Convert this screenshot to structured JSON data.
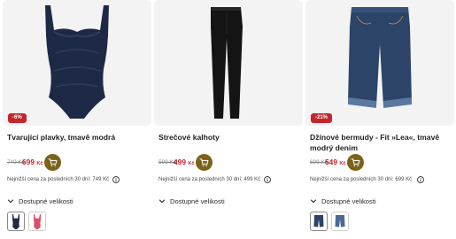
{
  "products": [
    {
      "badge": "-6%",
      "title": "Tvarující plavky, tmavě modrá",
      "old_price": "749 Kč",
      "new_price": "699",
      "currency": "Kč",
      "lowest_price": "Nejnižší cena za posledních 30 dní: 749 Kč",
      "sizes_label": "Dostupné velikosti",
      "colors": [
        "#1e2a45",
        "#d9506a"
      ],
      "icons": {
        "cart": "cart-icon",
        "info": "info-icon",
        "chevron": "chevron-down-icon"
      }
    },
    {
      "badge": "",
      "title": "Strečové kalhoty",
      "old_price": "599 Kč",
      "new_price": "499",
      "currency": "Kč",
      "lowest_price": "Nejnižší cena za posledních 30 dní: 499 Kč",
      "sizes_label": "Dostupné velikosti",
      "colors": [
        "#1a1a1a"
      ],
      "icons": {
        "cart": "cart-icon",
        "info": "info-icon",
        "chevron": "chevron-down-icon"
      }
    },
    {
      "badge": "-21%",
      "title": "Džínové bermudy - Fit »Lea«, tmavě modrý denim",
      "old_price": "699 Kč",
      "new_price": "549",
      "currency": "Kč",
      "lowest_price": "Nejnižší cena za posledních 30 dní: 699 Kč",
      "sizes_label": "Dostupné velikosti",
      "colors": [
        "#2c4467",
        "#4a6a94"
      ],
      "icons": {
        "cart": "cart-icon",
        "info": "info-icon",
        "chevron": "chevron-down-icon"
      }
    }
  ],
  "theme": {
    "accent": "#7a6318",
    "sale": "#c1272d"
  }
}
